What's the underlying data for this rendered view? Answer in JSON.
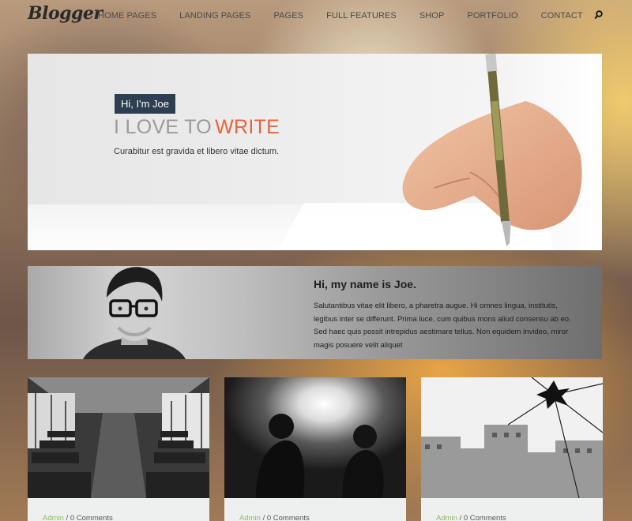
{
  "nav": {
    "logo": "Blogger",
    "menu": [
      "HOME PAGES",
      "LANDING PAGES",
      "PAGES",
      "FULL FEATURES",
      "SHOP",
      "PORTFOLIO",
      "CONTACT"
    ],
    "search_icon": "search-icon"
  },
  "hero": {
    "badge": "Hi, I'm Joe",
    "title_part1": "I LOVE TO",
    "title_part2": "WRITE",
    "subtitle": "Curabitur est gravida et libero vitae dictum.",
    "accent_color": "#e8643c",
    "badge_color": "#2c3e50"
  },
  "about": {
    "title": "Hi, my name is Joe.",
    "text": "Salutantibus vitae elit libero, a pharetra augue. Hi omnes lingua, institutis, legibus inter se differunt. Prima luce, cum quibus mons aliud  consensu ab eo. Sed haec quis possit intrepidus aestimare tellus. Non equidem invideo, miror magis posuere velit aliquet"
  },
  "posts": [
    {
      "author": "Admin",
      "separator": " / ",
      "comments": "0 Comments"
    },
    {
      "author": "Admin",
      "separator": " / ",
      "comments": "0 Comments"
    },
    {
      "author": "Admin",
      "separator": " / ",
      "comments": "0 Comments"
    }
  ]
}
